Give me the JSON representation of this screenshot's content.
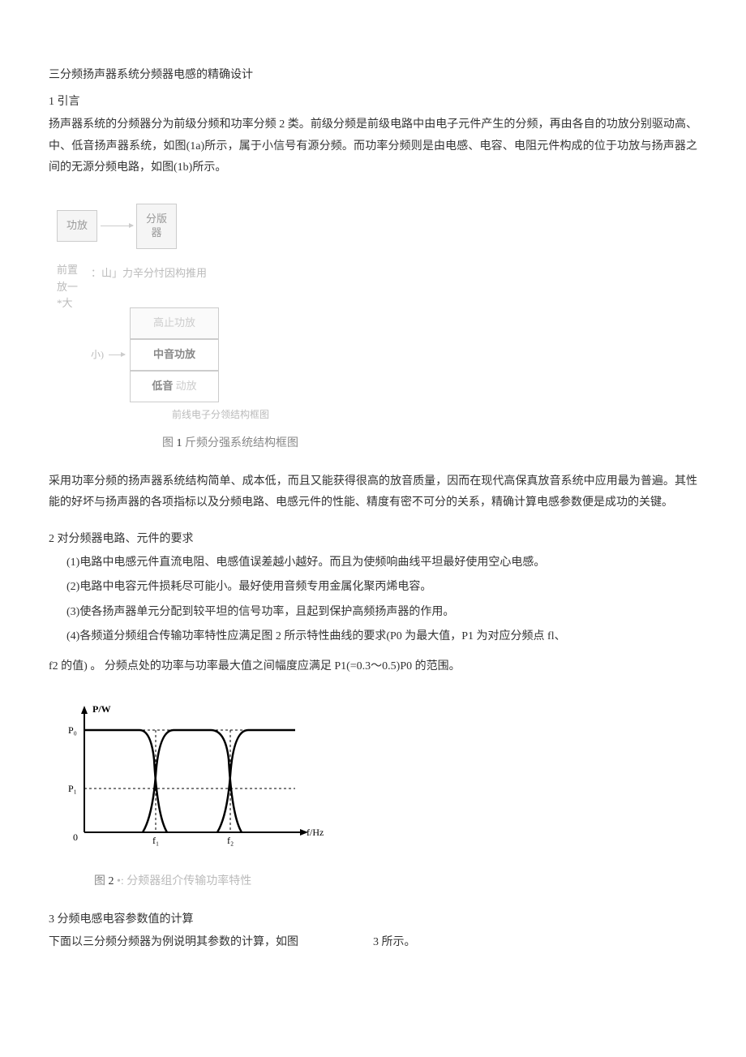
{
  "title": "三分频扬声器系统分频器电感的精确设计",
  "s1": {
    "heading": "1 引言",
    "p1": "扬声器系统的分频器分为前级分频和功率分频 2 类。前级分频是前级电路中由电子元件产生的分频，再由各自的功放分别驱动高、中、低音扬声器系统，如图(1a)所示，属于小信号有源分频。而功率分频则是由电感、电容、电阻元件构成的位于功放与扬声器之间的无源分频电路，如图(1b)所示。"
  },
  "fig1": {
    "a_left": "功放",
    "a_right": "分版器",
    "b_left_col": "前置放一*大",
    "b_mid_text": "：山」力辛分忖因构推用",
    "b_high": "高止功放",
    "b_mid": "中音功放",
    "b_low_strong": "低音",
    "b_low_rest": " 动放",
    "b_small": "小)",
    "sub_caption": "前线电子分领结构框图",
    "main_caption_pre": "图 ",
    "main_caption_num": "1",
    "main_caption_post": " 斤频分强系统结构框图"
  },
  "s1b": {
    "p2": "采用功率分频的扬声器系统结构简单、成本低，而且又能获得很高的放音质量，因而在现代高保真放音系统中应用最为普遍。其性能的好坏与扬声器的各项指标以及分频电路、电感元件的性能、精度有密不可分的关系，精确计算电感参数便是成功的关键。"
  },
  "s2": {
    "heading": "2 对分频器电路、元件的要求",
    "i1": "(1)电路中电感元件直流电阻、电感值误差越小越好。而且为使频响曲线平坦最好使用空心电感。",
    "i2": "(2)电路中电容元件损耗尽可能小。最好使用音频专用金属化聚丙烯电容。",
    "i3": "(3)使各扬声器单元分配到较平坦的信号功率，且起到保护高频扬声器的作用。",
    "i4": "(4)各频道分频组合传输功率特性应满足图 2 所示特性曲线的要求(P0 为最大值，P1 为对应分频点 fl、",
    "i4b": "f2 的值) 。 分频点处的功率与功率最大值之间幅度应满足 P1(=0.3～0.5)P0 的范围。"
  },
  "fig2": {
    "ylabel": "P/W",
    "y_top": "P₀",
    "y_mid": "P₁",
    "y_zero": "0",
    "x_f1": "f₁",
    "x_f2": "f₂",
    "xlabel": "f/Hz",
    "caption_pre": "图 ",
    "caption_num": "2",
    "caption_dot": "    •: ",
    "caption_post": "分颊器组介传输功率特性"
  },
  "s3": {
    "heading": "3 分频电感电容参数值的计算",
    "p_left": "下面以三分频分频器为例说明其参数的计算，如图",
    "p_right": "3 所示。"
  },
  "chart_data": {
    "type": "line",
    "title": "分频器组合传输功率特性",
    "xlabel": "f/Hz",
    "ylabel": "P/W",
    "x_ticks": [
      "0",
      "f1",
      "f2"
    ],
    "y_ticks": [
      "0",
      "P1",
      "P0"
    ],
    "ylim": [
      0,
      1
    ],
    "series": [
      {
        "name": "low",
        "x": [
          0.0,
          0.2,
          0.27,
          0.3,
          0.33,
          0.4
        ],
        "y": [
          1.0,
          1.0,
          0.8,
          0.4,
          0.1,
          0.0
        ]
      },
      {
        "name": "mid",
        "x": [
          0.2,
          0.27,
          0.3,
          0.33,
          0.4,
          0.55,
          0.62,
          0.65,
          0.68,
          0.75
        ],
        "y": [
          0.0,
          0.2,
          0.4,
          0.8,
          1.0,
          1.0,
          0.8,
          0.4,
          0.1,
          0.0
        ]
      },
      {
        "name": "high",
        "x": [
          0.55,
          0.62,
          0.65,
          0.68,
          0.75,
          1.0
        ],
        "y": [
          0.0,
          0.2,
          0.4,
          0.8,
          1.0,
          1.0
        ]
      }
    ],
    "crossover_level": 0.4,
    "crossover_x": [
      0.3,
      0.65
    ]
  }
}
